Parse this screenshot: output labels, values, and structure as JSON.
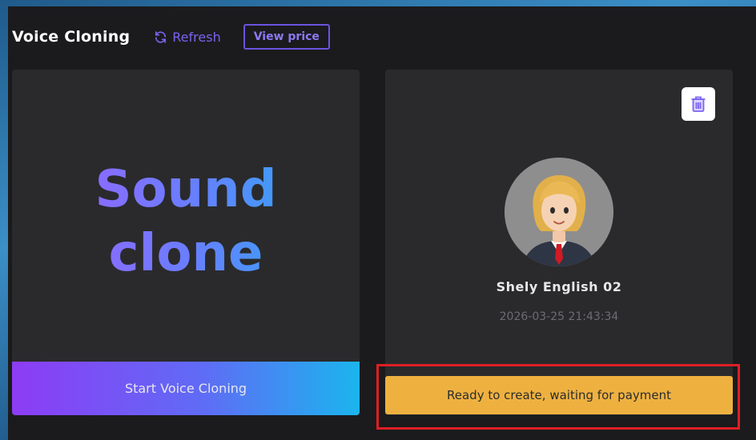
{
  "header": {
    "title": "Voice Cloning",
    "refresh_label": "Refresh",
    "view_price_label": "View price"
  },
  "left_card": {
    "hero_line1": "Sound",
    "hero_line2": "clone",
    "start_button_label": "Start Voice Cloning"
  },
  "right_card": {
    "voice_name": "Shely English 02",
    "created_at": "2026-03-25 21:43:34",
    "status_button_label": "Ready to create, waiting for payment",
    "delete_icon": "trash-icon"
  },
  "colors": {
    "accent": "#7c63f0",
    "status_button": "#eeb140",
    "highlight_border": "#e01e25"
  }
}
